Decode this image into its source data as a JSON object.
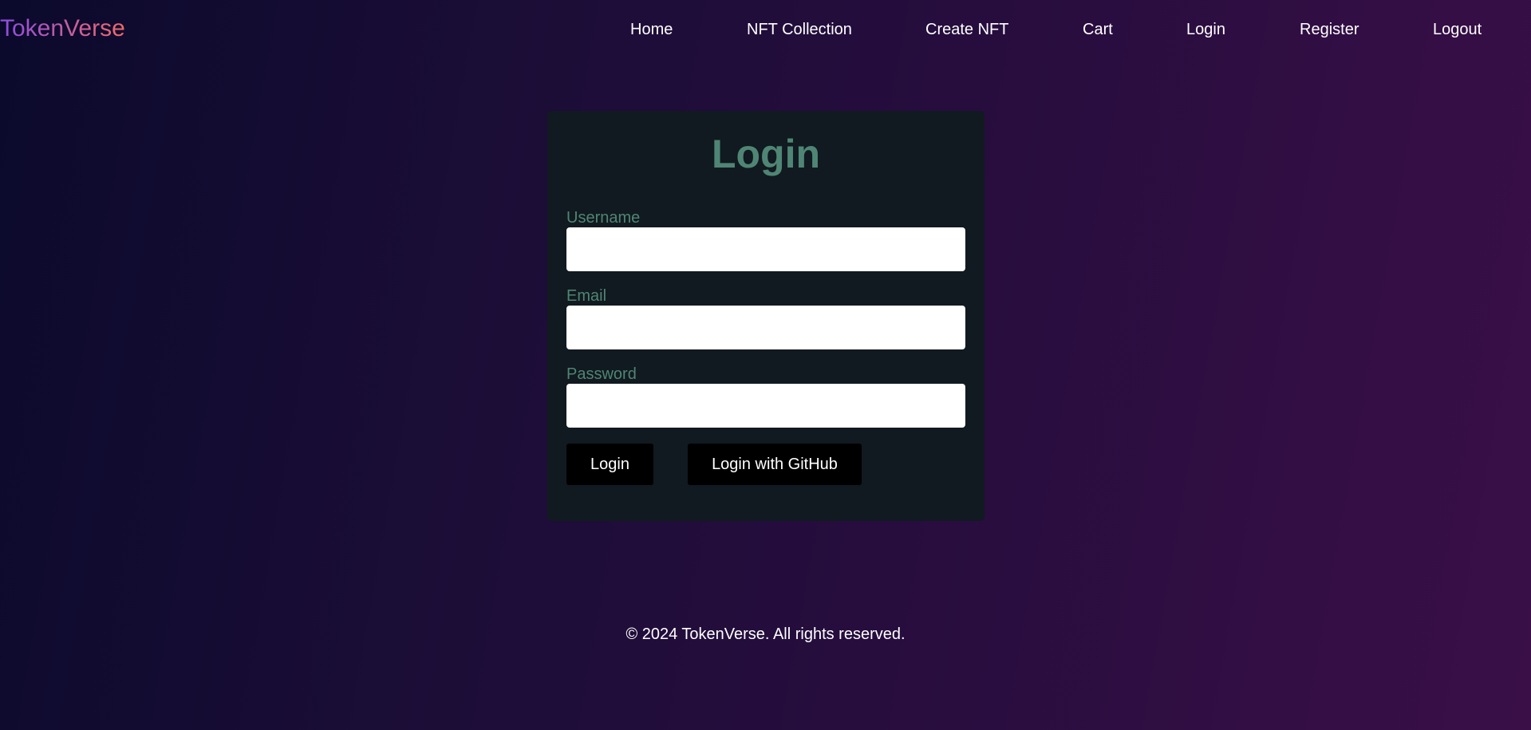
{
  "brand": {
    "name": "TokenVerse",
    "gradient": [
      "#8a4de0",
      "#c95f9a",
      "#f06a6a"
    ]
  },
  "nav": {
    "items": [
      {
        "label": "Home"
      },
      {
        "label": "NFT Collection"
      },
      {
        "label": "Create NFT"
      },
      {
        "label": "Cart"
      },
      {
        "label": "Login"
      },
      {
        "label": "Register"
      },
      {
        "label": "Logout"
      }
    ]
  },
  "login_card": {
    "title": "Login",
    "fields": {
      "username": {
        "label": "Username",
        "value": "",
        "placeholder": ""
      },
      "email": {
        "label": "Email",
        "value": "",
        "placeholder": ""
      },
      "password": {
        "label": "Password",
        "value": "",
        "placeholder": ""
      }
    },
    "buttons": {
      "login": "Login",
      "github": "Login with GitHub"
    }
  },
  "footer": {
    "text": "© 2024 TokenVerse. All rights reserved."
  },
  "colors": {
    "card_background": "#111a20",
    "accent_text": "#4f8574",
    "button_background": "#000000",
    "page_gradient": [
      "#0b0a2c",
      "#3a0f48"
    ]
  }
}
